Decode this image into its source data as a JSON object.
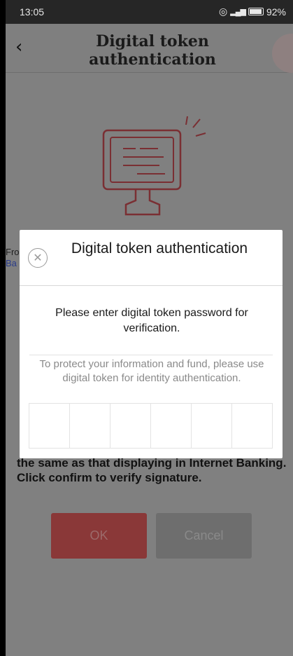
{
  "status_bar": {
    "time": "13:05",
    "signal": "4G",
    "battery": "92%"
  },
  "header": {
    "back_icon": "chevron-left-icon",
    "title": "Digital token authentication"
  },
  "background": {
    "left_text_line1": "Fro",
    "left_text_line2": "Ba",
    "instruction": "the same as that displaying in Internet Banking. Click confirm to verify signature.",
    "ok_label": "OK",
    "cancel_label": "Cancel"
  },
  "dialog": {
    "title": "Digital token authentication",
    "message": "Please enter digital token password for verification.",
    "hint": "To protect your information and fund, please use digital token for identity authentication.",
    "pin_length": 6
  },
  "colors": {
    "accent": "#c0393b",
    "overlay": "#808080"
  }
}
